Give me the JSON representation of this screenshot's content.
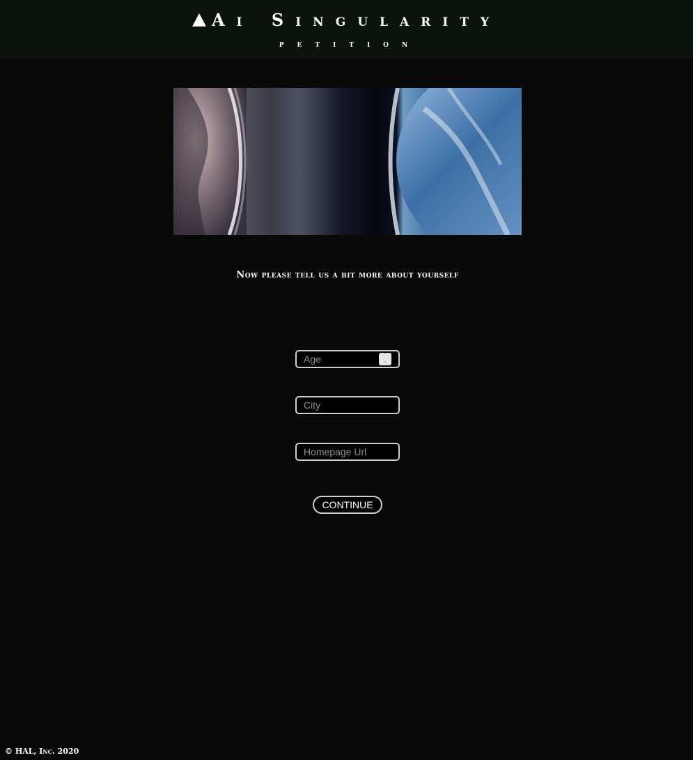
{
  "header": {
    "title": "Ai Singularity",
    "subtitle": "petition"
  },
  "main": {
    "prompt": "Now please tell us a bit more about yourself",
    "fields": {
      "age_placeholder": "Age",
      "city_placeholder": "City",
      "homepage_placeholder": "Homepage Url"
    },
    "continue_label": "CONTINUE"
  },
  "footer": {
    "copyright": "© HAL, Inc. 2020"
  },
  "icons": {
    "title_mark": "triangle-icon",
    "age_spinner": "number-spinner-icon"
  },
  "colors": {
    "page_background": "#090909",
    "header_background": "#0b140b",
    "field_border": "#cfcfcf",
    "text": "#ffffff",
    "placeholder": "#8f8f8f"
  }
}
